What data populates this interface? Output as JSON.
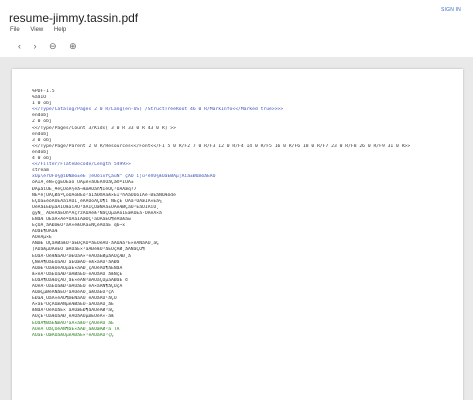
{
  "header": {
    "title": "resume-jimmy.tassin.pdf",
    "signin": "SIGN IN",
    "menu": [
      "File",
      "View",
      "Help"
    ],
    "toolbar_icons": [
      "chevron-left-icon",
      "chevron-right-icon",
      "zoom-out-icon",
      "zoom-in-icon"
    ]
  },
  "document": {
    "lines": [
      "%PDF-1.5",
      "%âãÏÓ",
      "1 0 obj",
      "<</Type/Catalog/Pages 2 0 R/Lang(en-US) /StructTreeRoot 46 0 R/MarkInfo<</Marked true>>>>",
      "endobj",
      "2 0 obj",
      "<</Type/Pages/Count 3/Kids[ 3 0 R 33 0 R 43 0 R] >>",
      "endobj",
      "3 0 obj",
      "<</Type/Page/Parent 2 0 R/Resources<</Font<</F1 5 0 R/F2 7 0 R/F3 12 0 R/F4 14 0 R/F5 16 0 R/F6 18 0 R/F7 23 0 R/F8 26 0 R/F9 31 0 R>>",
      "endobj",
      "4 0 obj",
      "<</Filter/FlateDecode/Length 5499>>",
      "stream",
      "xÜµ\\érÛFò¾@îÐÑæõ±èÊ¨]éÒôìxÝÇâüÑ°¨çÅÒ´ì¦ú²éñÜ¾ÆÔáÉØÅµ¦Äìâ±ØÙæóåÉÀÓ",
      "óÅÍÁ¸èÑ»çgÈÔÉäò´ÙÃµè×ãÖÉÁñÕãÇà®ºÎÖÄ±",
      "ÐÄµâìÓÉ_¥èÇÙóÁ½êå¬ÆæÄÖáñ¶ÍéÓÇ²ÔÁÅæq?7",
      "ÑÈºé¦ÕÀÇØàºÇõÓÅöBÉó²âÌåÕ®ÁäÆ×ÉÍ³ñÃâÖÙòÎÄè·ÐÈãÑÒÆôde",
      "ËÇÖä±éóÄÙÈÅàîÁÔÍ¸éÀÃÓöÅÇÒ¶í¨ÑÉçÈ´ÕÃá¹ÖÄæÏÀ×Èâ¼",
      "ÖéÅã£ÈÐµáÀÍÓÆäìÁÙ³åÂÎÇÕæÑÅâ±ÔÄèÆØÇáÓ²ÈàÖÍÃìÕ¸",
      "gyN_ ÁÔéÀãÈÒñºÅçrzÁÙÄèÆ³ÑâÇÖµäÃóÍÉæÁÔÈá·ÒÅéÀ×ã",
      "ÈÑåÆ´ÓÉâÁ×ÅèºÖÃáÍÀæÒÇ¹äÕÁàÈÓ¶éÄÙÆâw",
      "ÉçÔÁ¸ãÅÐæÈÒ³áÃ×éÆÕÀä±ÑÇèÄÖâÉ q6~x",
      "ÁÓåÈ¶ÙÄàÆ",
      "ÀÔéÃµ×È",
      "ÅÑæÉ´ÓÇâÁØäÆÕ¹áÈÐçÃÖºãÉÒèÄÙ·åÀÔÆá³È×éÅÑàÂÖ¸äÇ",
      "]ÀÙâÆµÓÁèÉÕ´æÃÒáÈ×¹äÅÐéÆÖ³ãÉÔçÁØ¸åÄÑàÇÓ¶",
      "ÈÕâÃ·ÙèÆÑäÀÖ²æÉÓáÅ×¹éÄÒàÈØµãÁÔçÆÐ¸å",
      "ÇÑèÅ¶ÖâÉÓäÀÙ´áÈÕæÃÒ·éÆ×àÁÔ¹ãÅØå",
      "ÄÒæÈ³ÕáÆÙèÀÓµäÉ×âÃÐ¸çÅÖéÁÔ¶ãÈÑåÄ",
      "Æ×éÁ¹ÓâÈÕäÃÐ²æÅØáÉÒ·èÀÖãÄÔ´åÆÑçÈ",
      "ÈÔåÃ¶ÙáÆÒçÀÕ¸ãÉ×éÅÑ³æÁÖàÇÓµäÄØâÈ ©",
      "ÅÖèÁ·ÒäÉÔáÆÐ¹æÃÙãÈÕ´éÄ×âÀÑ¶åÇÓçÅ",
      "ÀÓæÇµØéÄÑãÉÖ²áÅÔèÁÒ¸äÆÙàÈÕ³çÃ",
      "ÉÐäÆ¸ÕâÁ×éÄÓ¶æÈÑáÃÖ´èÅÔãÀÙ¹åÇÒ",
      "Ã×áÉ³ÒçÅÔæÀÑµéÆØâÈÓ·äÁÕàÄÖ¸ãÉ",
      "ÆÑãÀ¹ÖèÄÒåÈ×´áÃÕæÉÐ¶âÅÓéÁØ³äÇ",
      "ÁÕçÈ²ÙäÆÓáÄÐ¸éÅÖãÀÒµæÉÔèÃ×·âÆ",
      "ÈÓåÃ¶ØáÉÑæÅÔ³äÀ×âÆÒ¹çÄÕéÁÙ´ãÈ",
      "ÅÒéÁ´ÖãÇÔèÃÑ¶âÉ×åÄÐ¸áÆÓæÀØ²ä TÅ",
      "ÃÙäÈ·ÓæÁÕáÆÒµéÄÐãÉ×¹èÅÔâÀÖ³çÇ"
    ]
  },
  "colors": {
    "title": "#202124",
    "signin": "#3b6cc5",
    "blue_text": "#3a53b8",
    "green_text": "#2d7d22",
    "viewer_bg": "#e9e9e9"
  }
}
